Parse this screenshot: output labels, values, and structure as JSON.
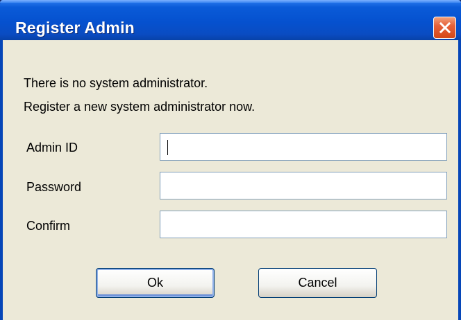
{
  "window": {
    "title": "Register Admin"
  },
  "message": {
    "line1": "There is no system administrator.",
    "line2": "Register a new system administrator now."
  },
  "form": {
    "admin_id_label": "Admin ID",
    "admin_id_value": "",
    "password_label": "Password",
    "password_value": "",
    "confirm_label": "Confirm",
    "confirm_value": ""
  },
  "buttons": {
    "ok_label": "Ok",
    "cancel_label": "Cancel"
  },
  "colors": {
    "titlebar": "#0551cf",
    "client_bg": "#ece9d8",
    "close_button": "#e6613a",
    "field_border": "#7f9db9"
  }
}
